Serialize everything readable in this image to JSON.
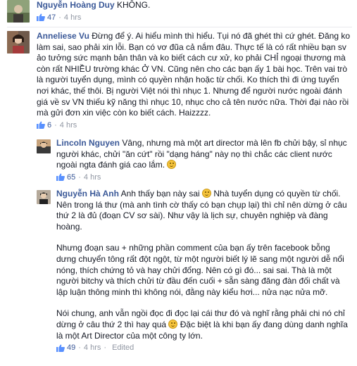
{
  "comments": [
    {
      "name": "Nguyễn Hoàng Duy",
      "text": "KHÔNG.",
      "likes": "47",
      "time": "4 hrs"
    },
    {
      "name": "Anneliese Vu",
      "text": "Đừng để ý. Ai hiểu mình thì hiểu. Tụi nó đã ghét thì cứ ghét. Đăng ko làm sai, sao phải xin lỗi. Bạn có vơ đũa cả nắm đâu. Thực tế là có rất nhiều bạn sv ảo tưởng sức mạnh bản thân và ko biết cách cư xử, ko phải CHỈ ngoại thương mà còn rất NHIỀU trường khác Ở VN. Cũng nên cho các bạn ấy 1 bài học. Trên vai trò là người tuyển dụng, mình có quyền nhận hoặc từ chối. Ko thích thì đi ứng tuyển nơi khác, thế thôi. Bị người Việt nói thì nhục 1. Nhưng để người nước ngoài đánh giá về sv VN thiếu kỹ năng thì nhục 10, nhục cho cả tên nước nữa. Thời đại nào rồi mà gửi đơn xin việc còn ko biết cách. Haizzzz.",
      "likes": "6",
      "time": "4 hrs"
    },
    {
      "name": "Lincoln Nguyen",
      "text": "Vâng, nhưng mà một art director mà lên fb chửi bậy, sỉ nhục người khác, chửi \"ăn cứt\" rồi \"dạng háng\" này nọ thì chắc các client nước ngoài ngta đánh giá cao lắm.",
      "likes": "65",
      "time": "4 hrs"
    },
    {
      "name": "Nguyễn Hà Anh",
      "para1a": "Anh thấy bạn này sai",
      "para1b": "Nhà tuyển dụng có quyền từ chối. Nên trong lá thư (mà anh tình cờ thấy có bạn chụp lại) thì chỉ nên dừng ở câu thứ 2 là đủ (đoạn CV sơ sài). Như vậy là lịch sự, chuyên nghiệp và đàng hoàng.",
      "para2": "Nhưng đoạn sau + những phần comment của bạn ấy trên facebook bỗng dưng chuyển tông rất đột ngột, từ một người biết lý lẽ sang một người dễ nổi nóng, thích chứng tỏ và hay chửi đổng. Nên có gì đó... sai sai. Thà là một người bitchy và thích chửi từ đầu đến cuối + sẵn sàng đăng đàn đối chất và lập luận thông minh thì không nói, đằng này kiểu hơi... nửa nạc nửa mỡ.",
      "para3a": "Nói chung, anh vẫn ngồi đọc đi đọc lại cái thư đó và nghĩ rằng phải chi nó chỉ dừng ở câu thứ 2 thì hay quá",
      "para3b": "Đặc biệt là khi bạn ấy đang dùng danh nghĩa là một Art Director của một công ty lớn.",
      "likes": "49",
      "time": "4 hrs",
      "edited": "Edited"
    }
  ]
}
